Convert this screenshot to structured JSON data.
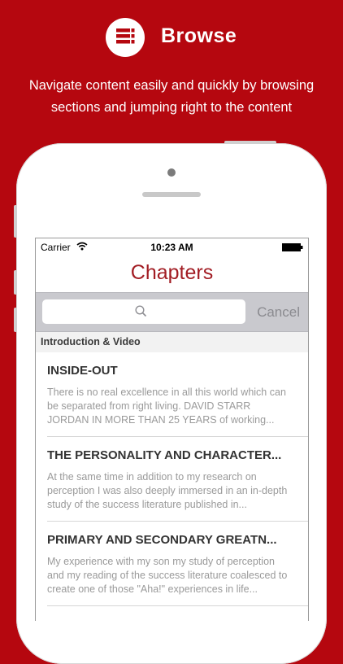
{
  "promo": {
    "title": "Browse",
    "subtitle_line1": "Navigate content easily and quickly by browsing",
    "subtitle_line2": "sections and jumping right to the content",
    "logo_icon": "list-icon"
  },
  "status_bar": {
    "carrier": "Carrier",
    "time": "10:23 AM"
  },
  "nav": {
    "title": "Chapters"
  },
  "search": {
    "placeholder": "",
    "cancel_label": "Cancel"
  },
  "section": {
    "header": "Introduction & Video"
  },
  "chapters": [
    {
      "title": "INSIDE-OUT",
      "excerpt": "There is no real excellence in all this world which can be separated from right living. DAVID STARR JORDAN IN MORE THAN 25 YEARS of working..."
    },
    {
      "title": "THE PERSONALITY AND CHARACTER...",
      "excerpt": "At the same time in addition to my research on perception I was also deeply immersed in an in-depth study of the success literature published in..."
    },
    {
      "title": "PRIMARY AND SECONDARY GREATN...",
      "excerpt": "My experience with my son my study of perception and my reading of the success literature coalesced to create one of those \"Aha!\" experiences in life..."
    }
  ],
  "colors": {
    "background": "#b5070f",
    "title_red": "#a21d24"
  }
}
